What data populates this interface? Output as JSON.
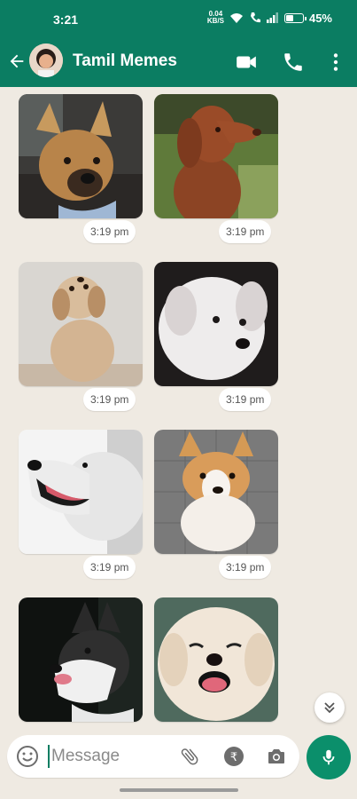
{
  "status_bar": {
    "time": "3:21",
    "net_speed_value": "0.04",
    "net_speed_unit": "KB/S",
    "battery": "45%",
    "battery_level": 0.45
  },
  "header": {
    "title": "Tamil Memes",
    "icons": [
      "back-arrow-icon",
      "video-call-icon",
      "phone-icon",
      "more-vert-icon"
    ],
    "color": "#0b7d62"
  },
  "messages": [
    {
      "time": "3:19 pm",
      "image": "dog-german-shepherd"
    },
    {
      "time": "3:19 pm",
      "image": "dog-vizsla"
    },
    {
      "time": "3:19 pm",
      "image": "dog-fluffy-tan"
    },
    {
      "time": "3:19 pm",
      "image": "puppy-white"
    },
    {
      "time": "3:19 pm",
      "image": "dog-white-retriever"
    },
    {
      "time": "3:19 pm",
      "image": "dog-corgi"
    },
    {
      "time": "",
      "image": "dog-husky"
    },
    {
      "time": "",
      "image": "dog-white-fluffy"
    }
  ],
  "input": {
    "placeholder": "Message"
  },
  "colors": {
    "accent": "#0b7d62",
    "chat_bg": "#efeae2",
    "mic": "#0b8f6b"
  }
}
